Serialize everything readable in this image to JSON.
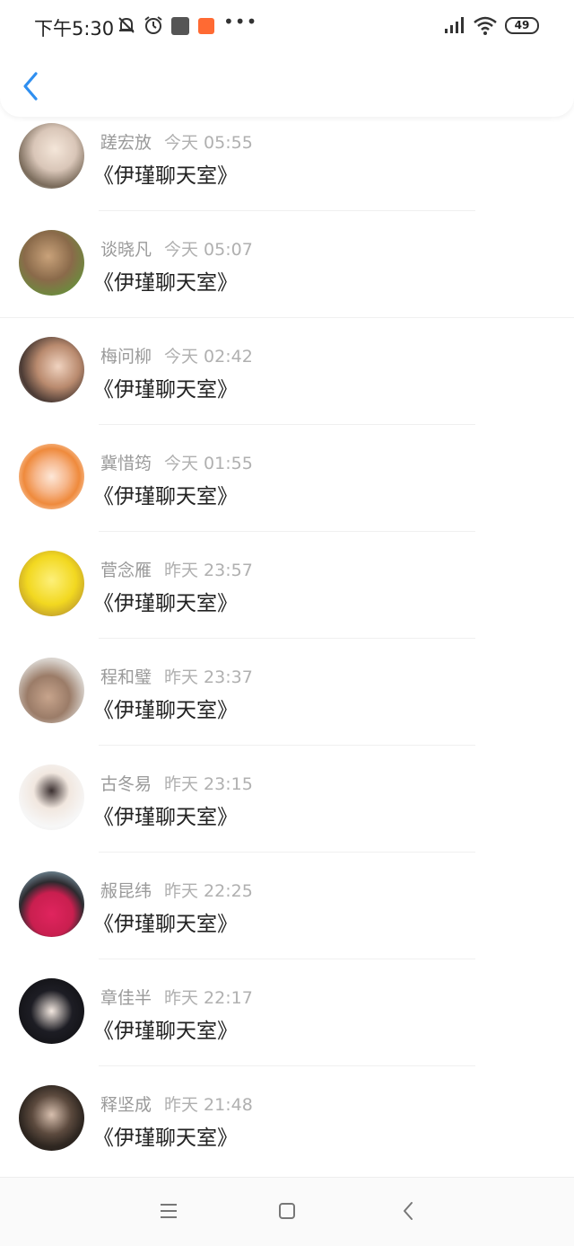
{
  "status_bar": {
    "time": "下午5:30",
    "battery": "49",
    "icons": [
      "bell-mute-icon",
      "alarm-icon",
      "mi-store-icon",
      "taobao-icon",
      "more-icon",
      "signal-hd-icon",
      "wifi-icon",
      "battery-icon"
    ]
  },
  "header": {
    "back_icon": "chevron-left-icon",
    "accent_color": "#2f8ff0"
  },
  "chats": [
    {
      "name": "蹉宏放",
      "time": "今天 05:55",
      "message": "《伊瑾聊天室》"
    },
    {
      "name": "谈晓凡",
      "time": "今天 05:07",
      "message": "《伊瑾聊天室》"
    },
    {
      "name": "梅问柳",
      "time": "今天 02:42",
      "message": "《伊瑾聊天室》"
    },
    {
      "name": "冀惜筠",
      "time": "今天 01:55",
      "message": "《伊瑾聊天室》"
    },
    {
      "name": "菅念雁",
      "time": "昨天 23:57",
      "message": "《伊瑾聊天室》"
    },
    {
      "name": "程和璧",
      "time": "昨天 23:37",
      "message": "《伊瑾聊天室》"
    },
    {
      "name": "古冬易",
      "time": "昨天 23:15",
      "message": "《伊瑾聊天室》"
    },
    {
      "name": "赧昆纬",
      "time": "昨天 22:25",
      "message": "《伊瑾聊天室》"
    },
    {
      "name": "章佳半",
      "time": "昨天 22:17",
      "message": "《伊瑾聊天室》"
    },
    {
      "name": "释坚成",
      "time": "昨天 21:48",
      "message": "《伊瑾聊天室》"
    }
  ],
  "nav_bar": {
    "icons": [
      "menu-icon",
      "home-square-icon",
      "back-triangle-icon"
    ]
  }
}
